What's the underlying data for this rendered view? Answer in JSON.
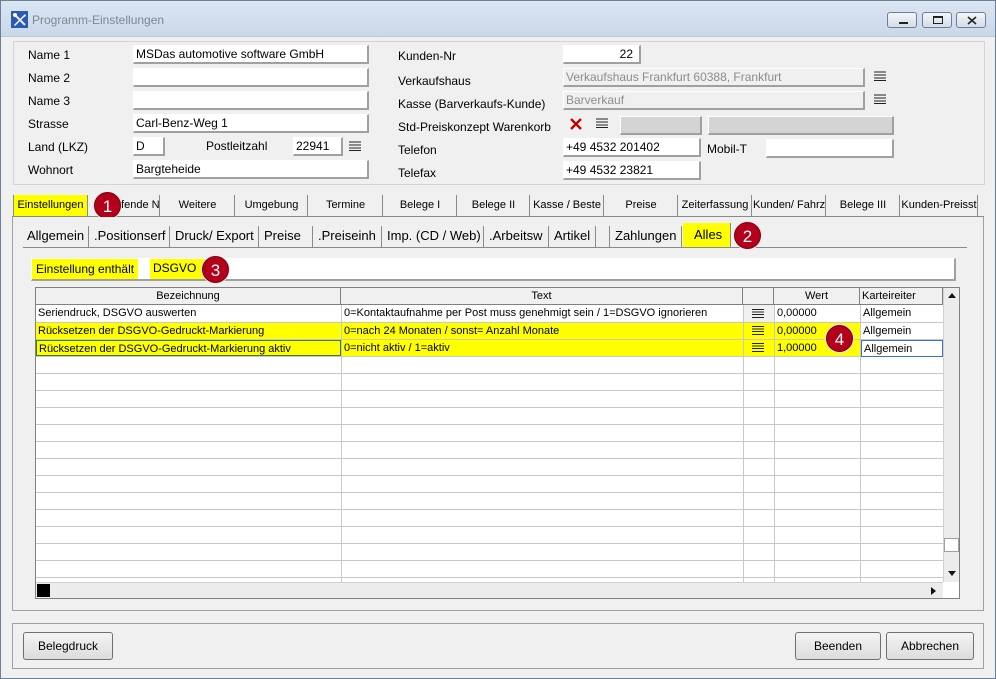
{
  "window": {
    "title": "Programm-Einstellungen"
  },
  "icons": {
    "app": "tools-icon",
    "minimize": "minimize-icon",
    "maximize": "maximize-icon",
    "close": "close-icon",
    "list": "list-icon",
    "clear": "x-icon"
  },
  "colors": {
    "highlight": "#ffff00",
    "badge": "#b4001b",
    "clear_x": "#c00000"
  },
  "form": {
    "name1": {
      "label": "Name 1",
      "value": "MSDas automotive software GmbH"
    },
    "name2": {
      "label": "Name 2",
      "value": ""
    },
    "name3": {
      "label": "Name 3",
      "value": ""
    },
    "strasse": {
      "label": "Strasse",
      "value": "Carl-Benz-Weg 1"
    },
    "land": {
      "label": "Land (LKZ)",
      "value": "D"
    },
    "plz": {
      "label": "Postleitzahl",
      "value": "22941"
    },
    "wohnort": {
      "label": "Wohnort",
      "value": "Bargteheide"
    },
    "kundennr": {
      "label": "Kunden-Nr",
      "value": "22"
    },
    "verkaufshaus": {
      "label": "Verkaufshaus",
      "value": "Verkaufshaus Frankfurt 60388, Frankfurt"
    },
    "kasse": {
      "label": "Kasse (Barverkaufs-Kunde)",
      "value": "Barverkauf"
    },
    "preiskonzept": {
      "label": "Std-Preiskonzept Warenkorb",
      "value": ""
    },
    "telefon": {
      "label": "Telefon",
      "value": "+49 4532 201402"
    },
    "mobil": {
      "label": "Mobil-T",
      "value": ""
    },
    "telefax": {
      "label": "Telefax",
      "value": "+49 4532 23821"
    }
  },
  "main_tabs": [
    "Einstellungen",
    "Rufende N",
    "Weitere",
    "Umgebung",
    "Termine",
    "Belege I",
    "Belege II",
    "Kasse / Beste",
    "Preise",
    "Zeiterfassung",
    "Kunden/ Fahrz",
    "Belege III",
    "Kunden-Preisst"
  ],
  "sub_tabs": [
    "Allgemein",
    ".Positionserf",
    "Druck/ Export",
    "Preise",
    ".Preiseinh",
    "Imp. (CD / Web)",
    ".Arbeitsw",
    "Artikel",
    "",
    "Zahlungen",
    "Alles"
  ],
  "filter": {
    "label": "Einstellung enthält",
    "value": "DSGVO"
  },
  "badges": [
    "1",
    "2",
    "3",
    "4"
  ],
  "table": {
    "columns": [
      "Bezeichnung",
      "Text",
      "",
      "Wert",
      "Karteireiter"
    ],
    "rows": [
      {
        "bezeichnung": "Seriendruck, DSGVO auswerten",
        "text": "0=Kontaktaufnahme per Post muss genehmigt sein / 1=DSGVO ignorieren",
        "wert": "0,00000",
        "karteireiter": "Allgemein"
      },
      {
        "bezeichnung": "Rücksetzen der DSGVO-Gedruckt-Markierung",
        "text": "0=nach 24 Monaten / sonst= Anzahl Monate",
        "wert": "0,00000",
        "karteireiter": "Allgemein"
      },
      {
        "bezeichnung": "Rücksetzen der DSGVO-Gedruckt-Markierung aktiv",
        "text": "0=nicht aktiv / 1=aktiv",
        "wert": "1,00000",
        "karteireiter": "Allgemein"
      }
    ]
  },
  "buttons": {
    "belegdruck": "Belegdruck",
    "beenden": "Beenden",
    "abbrechen": "Abbrechen"
  }
}
